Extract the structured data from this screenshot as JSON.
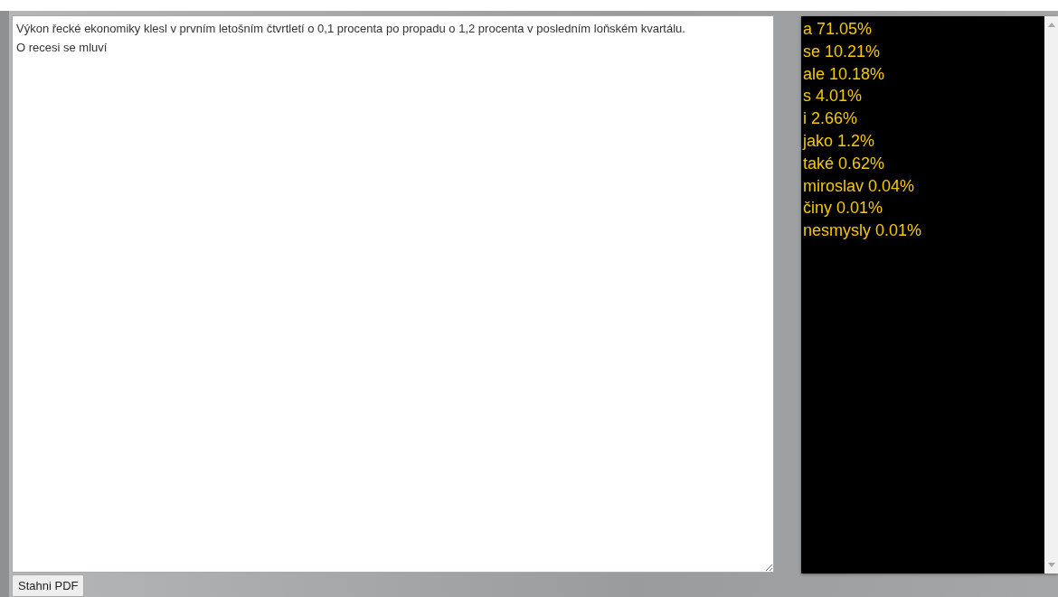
{
  "editor": {
    "value": "Výkon řecké ekonomiky klesl v prvním letošním čtvrtletí o 0,1 procenta po propadu o 1,2 procenta v posledním loňském kvartálu.\nO recesi se mluví"
  },
  "word_stats": [
    "a 71.05%",
    "se 10.21%",
    "ale 10.18%",
    "s 4.01%",
    "i 2.66%",
    "jako 1.2%",
    "také 0.62%",
    "miroslav 0.04%",
    "činy 0.01%",
    "nesmysly 0.01%"
  ],
  "download_button": "Stahni PDF"
}
